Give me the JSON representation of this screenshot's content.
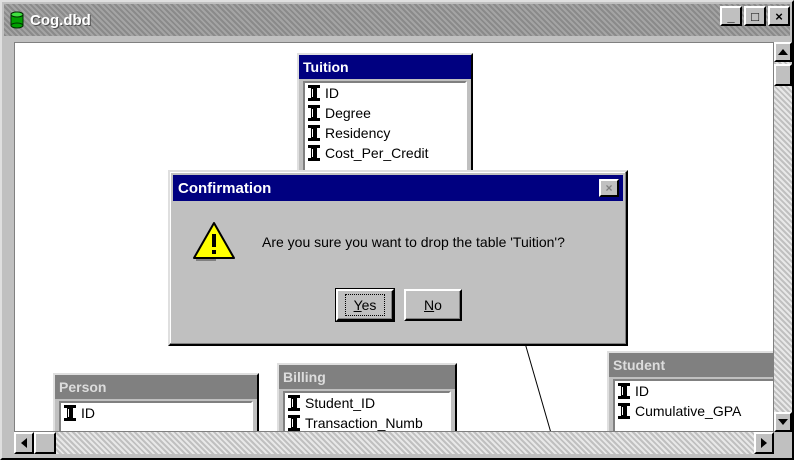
{
  "window": {
    "title": "Cog.dbd"
  },
  "titlebar_buttons": [
    "_",
    "□",
    "×"
  ],
  "tables": [
    {
      "name": "Tuition",
      "state": "active",
      "fields": [
        "ID",
        "Degree",
        "Residency",
        "Cost_Per_Credit"
      ]
    },
    {
      "name": "Person",
      "state": "inactive",
      "fields": [
        "ID"
      ]
    },
    {
      "name": "Billing",
      "state": "inactive",
      "fields": [
        "Student_ID",
        "Transaction_Numb"
      ]
    },
    {
      "name": "Student",
      "state": "inactive",
      "fields": [
        "ID",
        "Cumulative_GPA"
      ]
    }
  ],
  "dialog": {
    "title": "Confirmation",
    "close_label": "×",
    "message": "Are you sure you want to drop the table 'Tuition'?",
    "yes_prefix": "Y",
    "yes_rest": "es",
    "no_prefix": "N",
    "no_rest": "o"
  },
  "colors": {
    "active_title": "#000080",
    "inactive_title": "#808080",
    "face": "#c0c0c0"
  },
  "icons": [
    "database-icon",
    "key-field-icon",
    "warning-icon"
  ]
}
